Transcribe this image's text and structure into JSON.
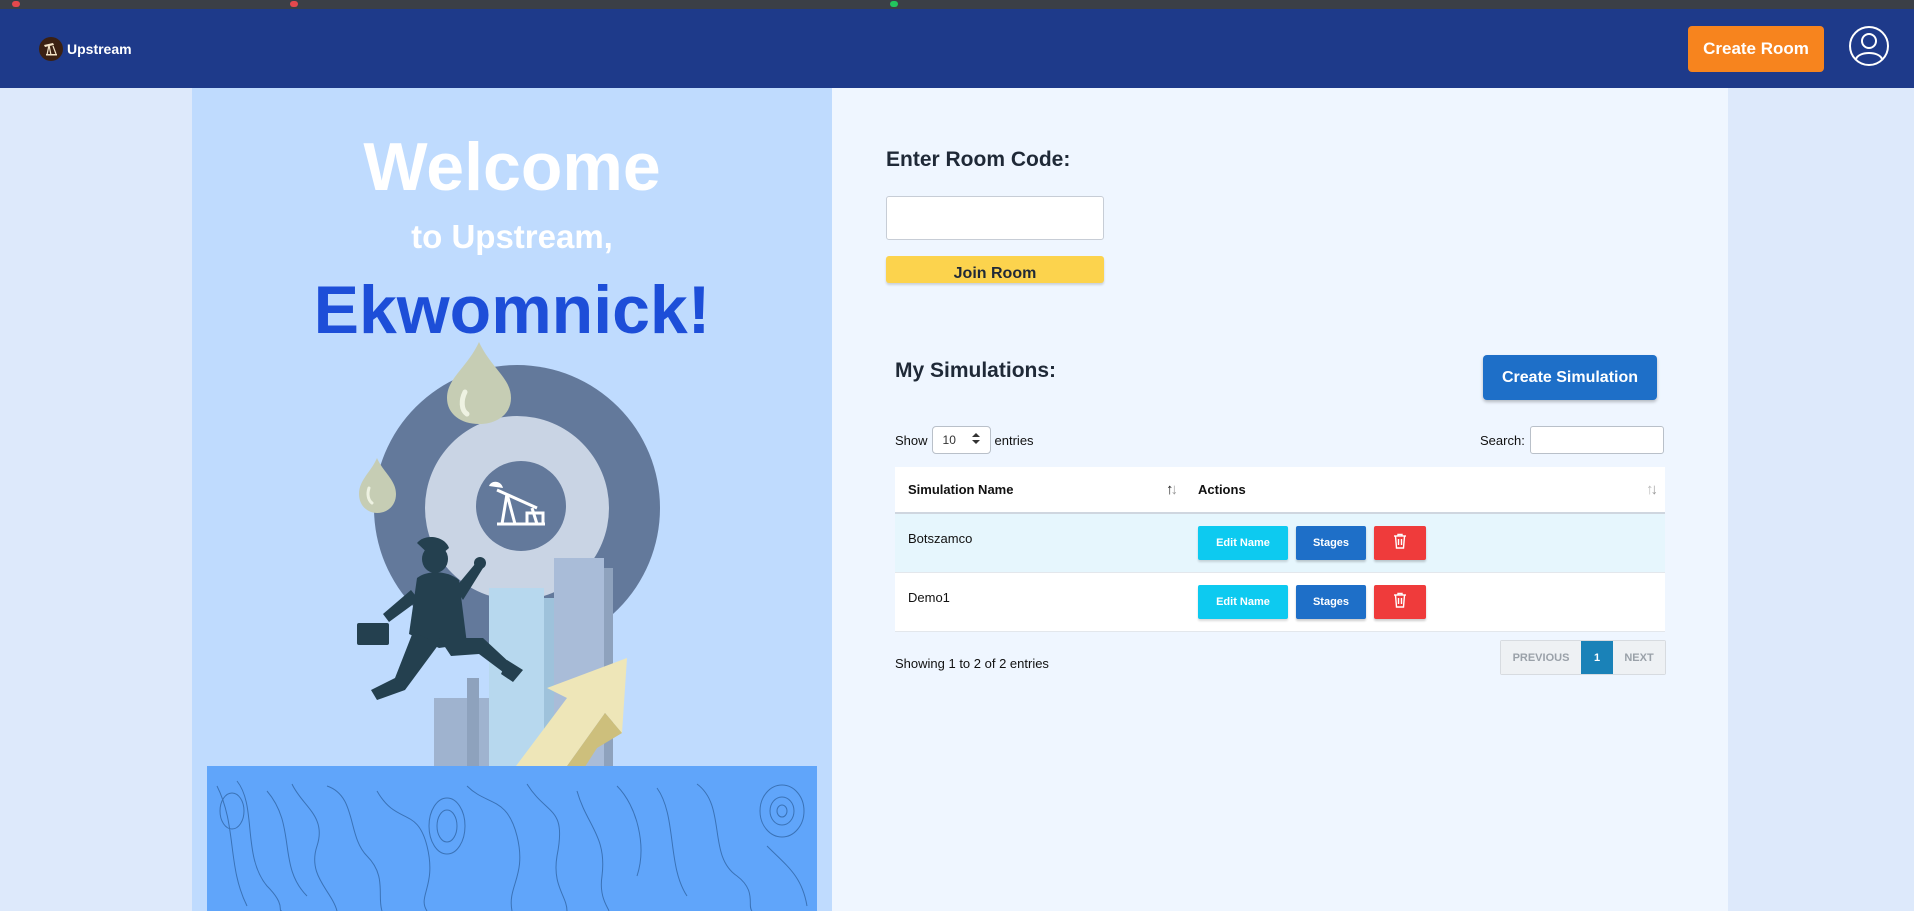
{
  "navbar": {
    "brand": "Upstream",
    "create_room_label": "Create Room"
  },
  "welcome": {
    "line1": "Welcome",
    "line2": "to Upstream,",
    "user_name": "Ekwomnick!"
  },
  "join": {
    "label": "Enter Room Code:",
    "input_value": "",
    "button_label": "Join Room"
  },
  "simulations": {
    "title": "My Simulations:",
    "create_label": "Create Simulation",
    "show_label": "Show",
    "entries_value": "10",
    "entries_label": "entries",
    "search_label": "Search:",
    "columns": [
      "Simulation Name",
      "Actions"
    ],
    "rows": [
      {
        "name": "Botszamco",
        "edit_label": "Edit Name",
        "stages_label": "Stages"
      },
      {
        "name": "Demo1",
        "edit_label": "Edit Name",
        "stages_label": "Stages"
      }
    ],
    "info": "Showing 1 to 2 of 2 entries",
    "pagination": {
      "previous": "PREVIOUS",
      "current": "1",
      "next": "NEXT"
    }
  },
  "colors": {
    "navbar": "#1e3a8a",
    "create_room": "#f7841e",
    "join_button": "#fcd34d",
    "primary_blue": "#1e6fc8",
    "edit_cyan": "#0dcaf0",
    "delete_red": "#ef3b3b",
    "user_name": "#1d4ed8"
  },
  "icons": {
    "brand": "pumpjack-logo-icon",
    "user": "user-circle-icon",
    "delete": "trash-icon",
    "sort": "sort-arrows-icon"
  }
}
